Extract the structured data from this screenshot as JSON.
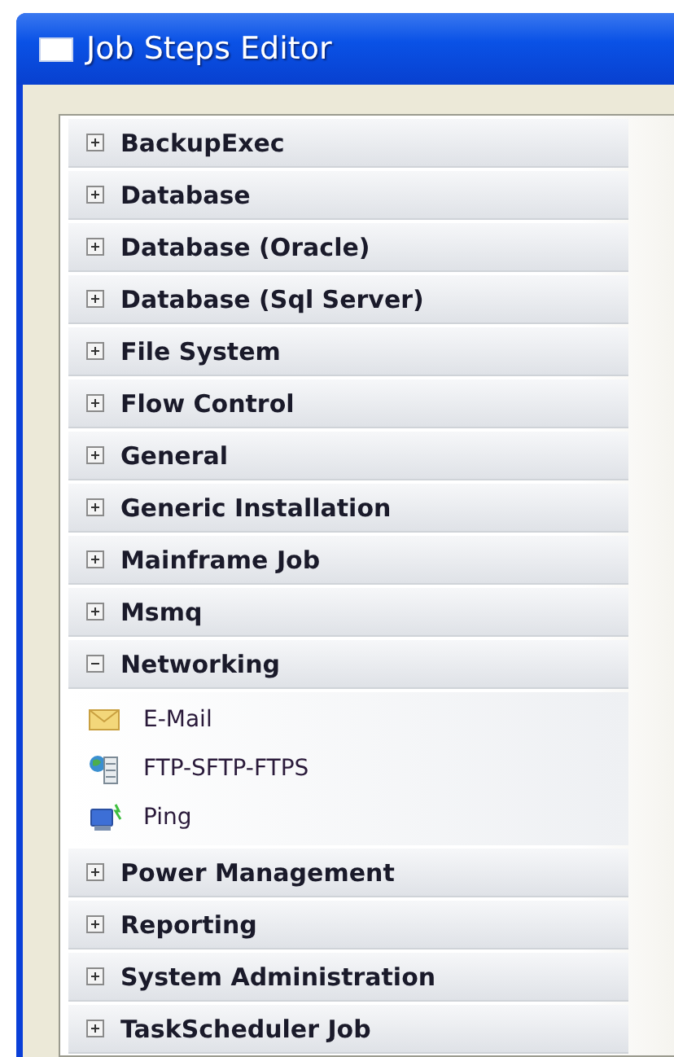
{
  "window": {
    "title": "Job Steps Editor"
  },
  "groups": [
    {
      "label": "BackupExec",
      "expanded": false
    },
    {
      "label": "Database",
      "expanded": false
    },
    {
      "label": "Database (Oracle)",
      "expanded": false
    },
    {
      "label": "Database (Sql Server)",
      "expanded": false
    },
    {
      "label": "File System",
      "expanded": false
    },
    {
      "label": "Flow Control",
      "expanded": false
    },
    {
      "label": "General",
      "expanded": false
    },
    {
      "label": "Generic Installation",
      "expanded": false
    },
    {
      "label": "Mainframe Job",
      "expanded": false
    },
    {
      "label": "Msmq",
      "expanded": false
    },
    {
      "label": "Networking",
      "expanded": true,
      "children": [
        {
          "label": "E-Mail",
          "kind": "envelope"
        },
        {
          "label": "FTP-SFTP-FTPS",
          "kind": "server"
        },
        {
          "label": "Ping",
          "kind": "computer"
        }
      ]
    },
    {
      "label": "Power Management",
      "expanded": false
    },
    {
      "label": "Reporting",
      "expanded": false
    },
    {
      "label": "System Administration",
      "expanded": false
    },
    {
      "label": "TaskScheduler Job",
      "expanded": false
    }
  ]
}
